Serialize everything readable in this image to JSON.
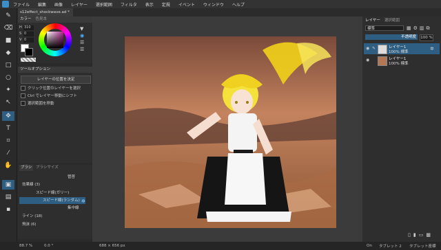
{
  "menubar": {
    "items": [
      "ファイル",
      "編集",
      "画像",
      "レイヤー",
      "選択範囲",
      "フィルタ",
      "表示",
      "定規",
      "イベント",
      "ウィンドウ",
      "ヘルプ"
    ]
  },
  "document": {
    "tab_title": "s12effect_shockwave.ad *"
  },
  "color_panel": {
    "tabs": [
      "カラー",
      "色見本"
    ],
    "h_label": "H",
    "h_value": "310",
    "s_label": "S",
    "s_value": "0",
    "v_label": "V",
    "v_value": "0"
  },
  "tool_options": {
    "title": "ツールオプション",
    "button": "レイヤーの位置を決定",
    "checkboxes": [
      "クリック位置のレイヤーを選択",
      "Ctrl でレイヤー移動にシフト",
      "選択範囲を移動"
    ]
  },
  "brush_panel": {
    "tabs": [
      "ブラシ",
      "ブラシサイズ"
    ],
    "rows": [
      {
        "label": "管啓",
        "selected": false
      },
      {
        "label": "効果線 (3)",
        "selected": false
      },
      {
        "label": "スピード線(ガリー)",
        "selected": false
      },
      {
        "label": "スピード線(ランダム)",
        "selected": true
      },
      {
        "label": "集中線",
        "selected": false
      },
      {
        "label": "ライン (18)",
        "selected": false
      },
      {
        "label": "飛沫 (6)",
        "selected": false
      }
    ]
  },
  "layer_panel": {
    "tabs": [
      "レイヤー",
      "選択範囲"
    ],
    "blend_mode": "標準",
    "opacity_label": "不透明度",
    "opacity_value": "100 %",
    "layers": [
      {
        "name": "レイヤー1",
        "mode": "100% 標準",
        "selected": true
      },
      {
        "name": "レイヤー1",
        "mode": "100% 標準",
        "selected": false
      }
    ]
  },
  "status": {
    "zoom": "88.7 %",
    "angle": "0.0 °",
    "canvas_size": "688 × 656 px",
    "tablet_on": "On",
    "tablet": "タブレット 2",
    "tablet_coords": "タブレット座標"
  }
}
